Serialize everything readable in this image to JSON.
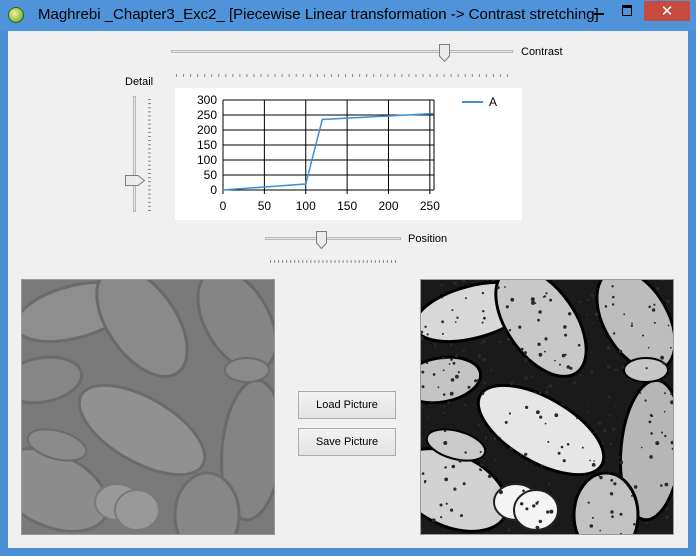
{
  "window": {
    "title": "Maghrebi _Chapter3_Exc2_ [Piecewise Linear transformation -> Contrast stretching]",
    "close_glyph": "✕",
    "icon": "app-icon"
  },
  "controls": {
    "contrast_label": "Contrast",
    "detail_label": "Detail",
    "position_label": "Position",
    "contrast_level": 0.81,
    "position_level": 0.41,
    "detail_level": 0.73
  },
  "buttons": {
    "load": "Load Picture",
    "save": "Save Picture"
  },
  "chart_data": {
    "type": "line",
    "x_ticks": [
      "0",
      "50",
      "100",
      "150",
      "200",
      "250"
    ],
    "y_ticks": [
      "0",
      "50",
      "100",
      "150",
      "200",
      "250",
      "300"
    ],
    "xlim": [
      0,
      255
    ],
    "ylim": [
      0,
      300
    ],
    "grid": true,
    "legend_position": "top-right",
    "series": [
      {
        "name": "A",
        "color": "#3c8fd6",
        "x": [
          0,
          100,
          120,
          255
        ],
        "y": [
          0,
          20,
          235,
          255
        ]
      }
    ]
  },
  "images": {
    "left": "original-low-contrast-image",
    "right": "contrast-stretched-image"
  }
}
